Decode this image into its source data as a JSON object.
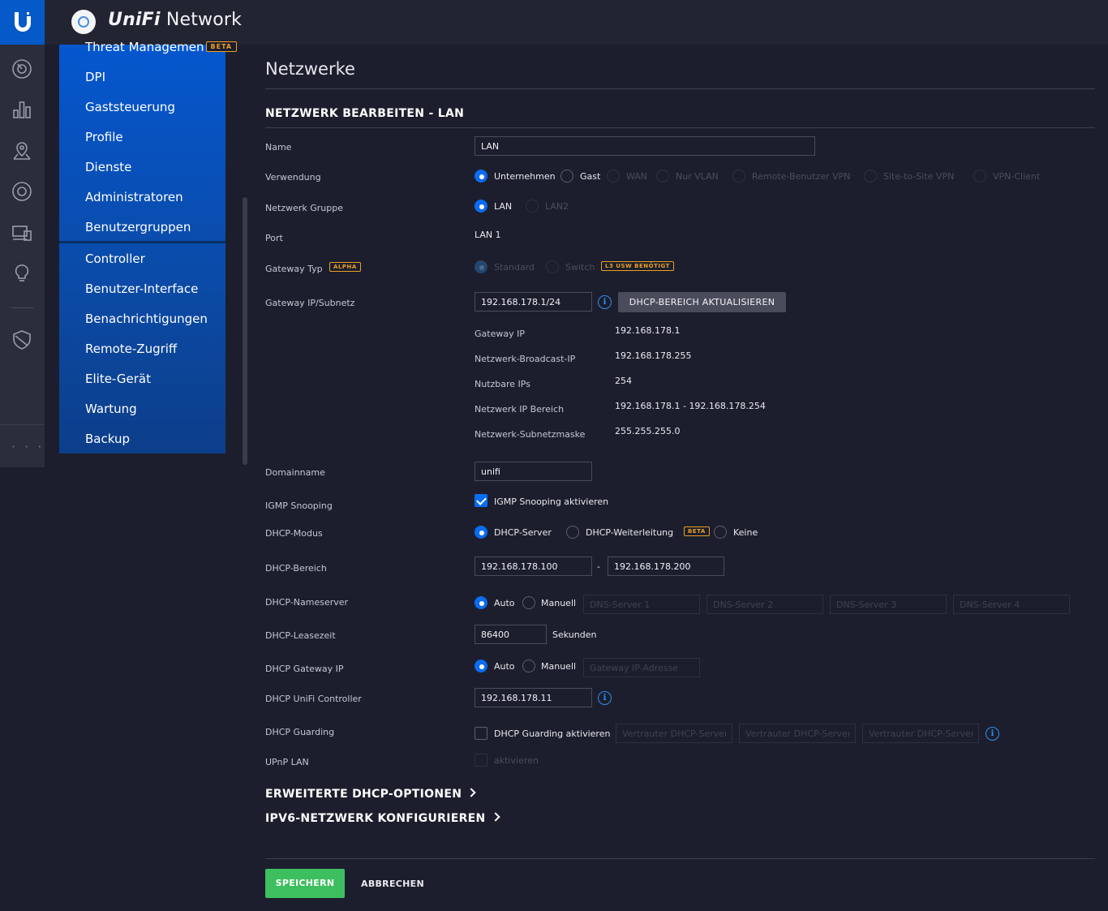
{
  "app": {
    "brand_bold": "UniFi",
    "brand_rest": " Network"
  },
  "sidebar": {
    "items": [
      {
        "label": "Threat Managemen",
        "badge": "BETA"
      },
      {
        "label": "DPI"
      },
      {
        "label": "Gaststeuerung"
      },
      {
        "label": "Profile"
      },
      {
        "label": "Dienste"
      },
      {
        "label": "Administratoren"
      },
      {
        "label": "Benutzergruppen"
      },
      {
        "label": "Controller"
      },
      {
        "label": "Benutzer-Interface"
      },
      {
        "label": "Benachrichtigungen"
      },
      {
        "label": "Remote-Zugriff"
      },
      {
        "label": "Elite-Gerät"
      },
      {
        "label": "Wartung"
      },
      {
        "label": "Backup"
      }
    ]
  },
  "rail": {
    "icons": [
      "unifi-logo-icon",
      "dashboard-icon",
      "statistics-icon",
      "map-icon",
      "devices-icon",
      "clients-icon",
      "insights-icon",
      "shield-icon",
      "more-icon"
    ],
    "more": "· · ·"
  },
  "page": {
    "title": "Netzwerke",
    "section_title": "NETZWERK BEARBEITEN - LAN"
  },
  "form": {
    "name": {
      "label": "Name",
      "value": "LAN"
    },
    "verwendung": {
      "label": "Verwendung",
      "options": [
        "Unternehmen",
        "Gast",
        "WAN",
        "Nur VLAN",
        "Remote-Benutzer VPN",
        "Site-to-Site VPN",
        "VPN-Client"
      ],
      "selected": "Unternehmen"
    },
    "netzwerk_gruppe": {
      "label": "Netzwerk Gruppe",
      "options": [
        "LAN",
        "LAN2"
      ],
      "selected": "LAN"
    },
    "port": {
      "label": "Port",
      "value": "LAN 1"
    },
    "gateway_typ": {
      "label": "Gateway Typ",
      "badge": "ALPHA",
      "options": [
        "Standard",
        "Switch"
      ],
      "selected": "Standard",
      "switch_badge": "L3 USW BENÖTIGT"
    },
    "gateway_ip": {
      "label": "Gateway IP/Subnetz",
      "value": "192.168.178.1/24",
      "info": "i",
      "button": "DHCP-BEREICH AKTUALISIEREN",
      "details": [
        {
          "key": "Gateway IP",
          "value": "192.168.178.1"
        },
        {
          "key": "Netzwerk-Broadcast-IP",
          "value": "192.168.178.255"
        },
        {
          "key": "Nutzbare IPs",
          "value": "254"
        },
        {
          "key": "Netzwerk IP Bereich",
          "value": "192.168.178.1 - 192.168.178.254"
        },
        {
          "key": "Netzwerk-Subnetzmaske",
          "value": "255.255.255.0"
        }
      ]
    },
    "domainname": {
      "label": "Domainname",
      "value": "unifi"
    },
    "igmp": {
      "label": "IGMP Snooping",
      "checkbox": "IGMP Snooping aktivieren",
      "checked": true
    },
    "dhcp_modus": {
      "label": "DHCP-Modus",
      "options": [
        "DHCP-Server",
        "DHCP-Weiterleitung",
        "Keine"
      ],
      "selected": "DHCP-Server",
      "badge": "BETA"
    },
    "dhcp_bereich": {
      "label": "DHCP-Bereich",
      "start": "192.168.178.100",
      "sep": "-",
      "end": "192.168.178.200"
    },
    "dhcp_nameserver": {
      "label": "DHCP-Nameserver",
      "options": [
        "Auto",
        "Manuell"
      ],
      "selected": "Auto",
      "placeholders": [
        "DNS-Server 1",
        "DNS-Server 2",
        "DNS-Server 3",
        "DNS-Server 4"
      ]
    },
    "dhcp_lease": {
      "label": "DHCP-Leasezeit",
      "value": "86400",
      "unit": "Sekunden"
    },
    "dhcp_gateway": {
      "label": "DHCP Gateway IP",
      "options": [
        "Auto",
        "Manuell"
      ],
      "selected": "Auto",
      "placeholder": "Gateway IP-Adresse"
    },
    "dhcp_controller": {
      "label": "DHCP UniFi Controller",
      "value": "192.168.178.11",
      "info": "i"
    },
    "dhcp_guarding": {
      "label": "DHCP Guarding",
      "checkbox": "DHCP Guarding aktivieren",
      "checked": false,
      "placeholders": [
        "Vertrauter DHCP-Server",
        "Vertrauter DHCP-Server",
        "Vertrauter DHCP-Server"
      ],
      "info": "i"
    },
    "upnp": {
      "label": "UPnP LAN",
      "checkbox": "aktivieren",
      "checked": false
    }
  },
  "links": {
    "dhcp_options": "ERWEITERTE DHCP-OPTIONEN",
    "ipv6": "IPV6-NETZWERK KONFIGURIEREN"
  },
  "actions": {
    "save": "SPEICHERN",
    "cancel": "ABBRECHEN"
  },
  "colors": {
    "accent": "#0a6cf0",
    "sidebar": "#0557cf",
    "save": "#3dbf60",
    "badge": "#e8a025"
  }
}
